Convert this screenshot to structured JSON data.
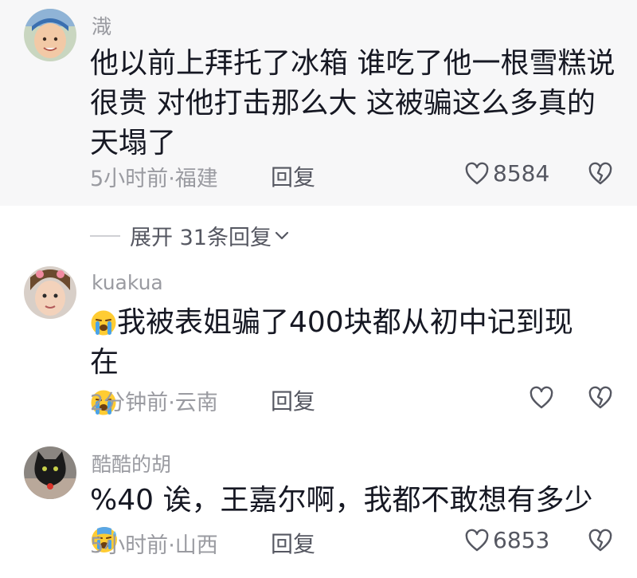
{
  "comments": [
    {
      "username": "渽",
      "text": "他以前上拜托了冰箱 谁吃了他一根雪糕说很贵 对他打击那么大 这被骗这么多真的天塌了",
      "time": "5小时前",
      "location": "福建",
      "reply_label": "回复",
      "likes": "8584",
      "avatar_icon": "avatar-child-photo"
    },
    {
      "username": "kuakua",
      "text_before": "我被表姐骗了400块都从初中记到现在",
      "emoji_name": "loudly-crying-face-icon",
      "time": "2分钟前",
      "location": "云南",
      "reply_label": "回复",
      "likes": "",
      "avatar_icon": "avatar-child-photo"
    },
    {
      "username": "酷酷的胡",
      "text": "%40 诶，王嘉尔啊，我都不敢想有多少",
      "emoji_name": "anxious-sweat-face-icon",
      "time": "5小时前",
      "location": "山西",
      "reply_label": "回复",
      "likes": "6853",
      "avatar_icon": "avatar-black-cat-photo"
    }
  ],
  "expand_replies_label": "展开 31条回复",
  "meta_separator": "·",
  "colors": {
    "text": "#161823",
    "secondary": "#9a9ba1",
    "action": "#555761",
    "first_bg": "#f7f7f8"
  }
}
